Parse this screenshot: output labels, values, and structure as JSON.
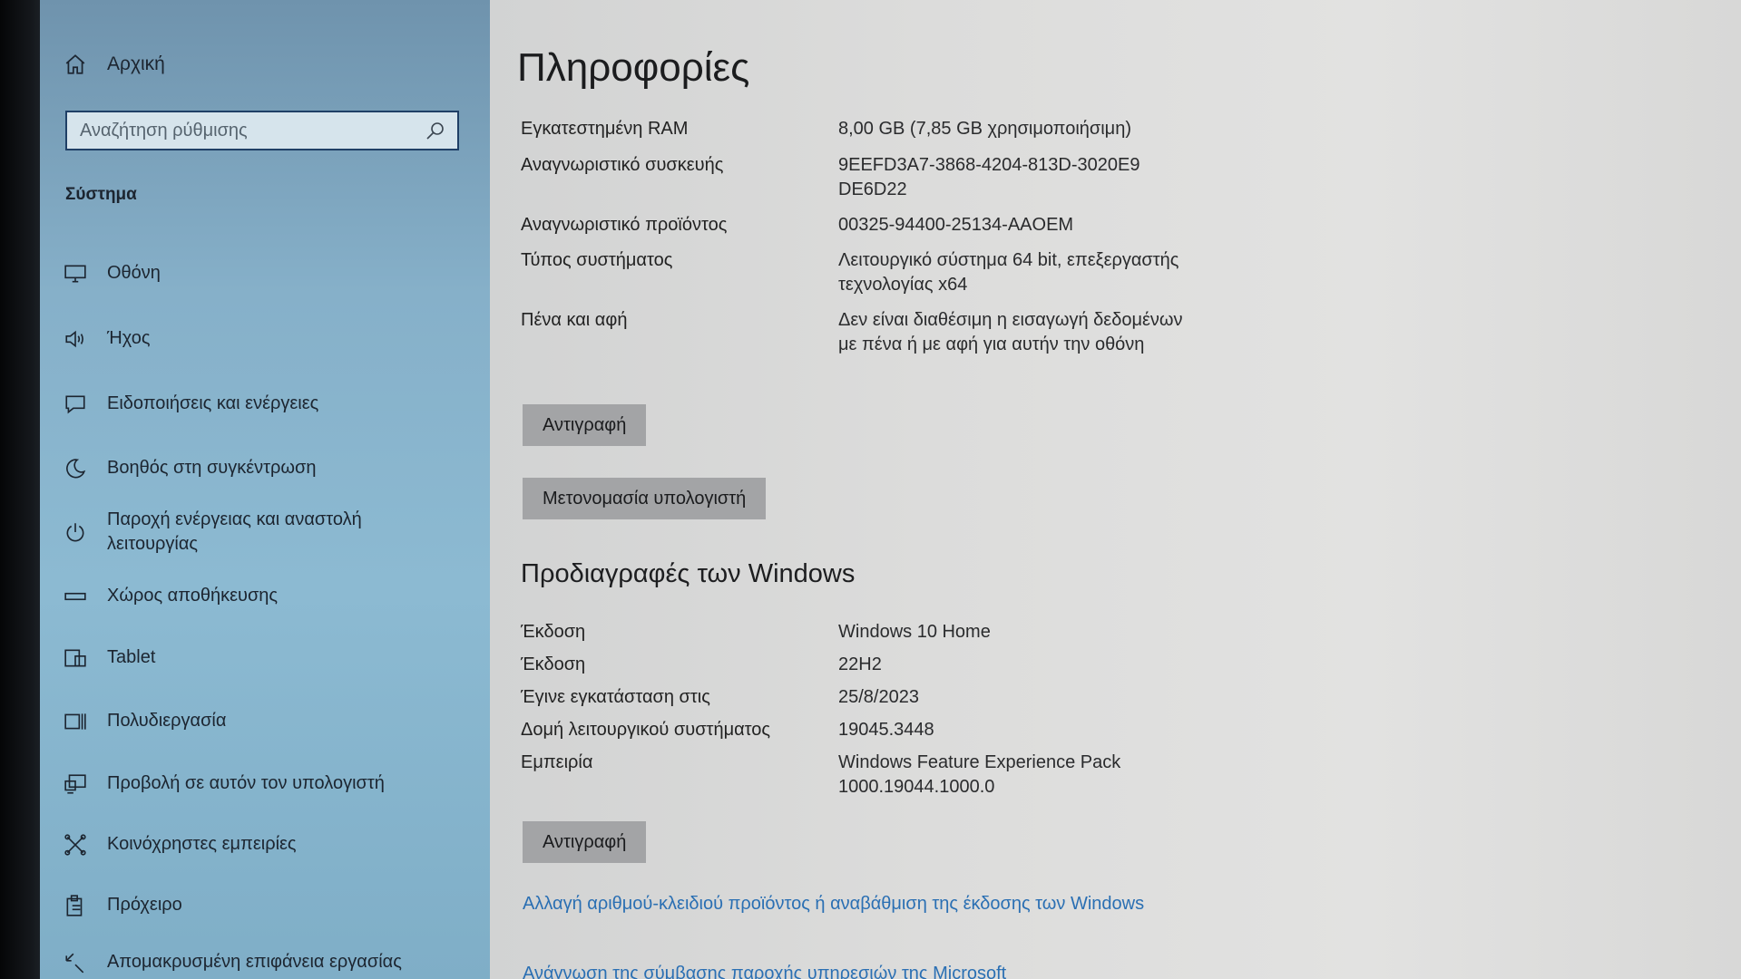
{
  "sidebar": {
    "home_label": "Αρχική",
    "search_placeholder": "Αναζήτηση ρύθμισης",
    "section_heading": "Σύστημα",
    "items": [
      {
        "label": "Οθόνη",
        "icon": "monitor-icon"
      },
      {
        "label": "Ήχος",
        "icon": "speaker-icon"
      },
      {
        "label": "Ειδοποιήσεις και ενέργειες",
        "icon": "notification-icon"
      },
      {
        "label": "Βοηθός στη συγκέντρωση",
        "icon": "moon-icon"
      },
      {
        "label": "Παροχή ενέργειας και αναστολή λειτουργίας",
        "icon": "power-icon"
      },
      {
        "label": "Χώρος αποθήκευσης",
        "icon": "storage-icon"
      },
      {
        "label": "Tablet",
        "icon": "tablet-icon"
      },
      {
        "label": "Πολυδιεργασία",
        "icon": "multitasking-icon"
      },
      {
        "label": "Προβολή σε αυτόν τον υπολογιστή",
        "icon": "projection-icon"
      },
      {
        "label": "Κοινόχρηστες εμπειρίες",
        "icon": "shared-experiences-icon"
      },
      {
        "label": "Πρόχειρο",
        "icon": "clipboard-icon"
      },
      {
        "label": "Απομακρυσμένη επιφάνεια εργασίας",
        "icon": "remote-desktop-icon"
      }
    ]
  },
  "main": {
    "title": "Πληροφορίες",
    "device_specs": [
      {
        "key": "Εγκατεστημένη RAM",
        "value": "8,00 GB (7,85 GB χρησιμοποιήσιμη)"
      },
      {
        "key": "Αναγνωριστικό συσκευής",
        "value": "9EEFD3A7-3868-4204-813D-3020E9 DE6D22"
      },
      {
        "key": "Αναγνωριστικό προϊόντος",
        "value": "00325-94400-25134-AAOEM"
      },
      {
        "key": "Τύπος συστήματος",
        "value": "Λειτουργικό σύστημα 64 bit, επεξεργαστής τεχνολογίας x64"
      },
      {
        "key": "Πένα και αφή",
        "value": "Δεν είναι διαθέσιμη η εισαγωγή δεδομένων με πένα ή με αφή για αυτήν την οθόνη"
      }
    ],
    "copy_button_1": "Αντιγραφή",
    "rename_button": "Μετονομασία υπολογιστή",
    "windows_heading": "Προδιαγραφές των Windows",
    "windows_specs": [
      {
        "key": "Έκδοση",
        "value": "Windows 10 Home"
      },
      {
        "key": "Έκδοση",
        "value": "22H2"
      },
      {
        "key": "Έγινε εγκατάσταση στις",
        "value": "25/8/2023"
      },
      {
        "key": "Δομή λειτουργικού συστήματος",
        "value": "19045.3448"
      },
      {
        "key": "Εμπειρία",
        "value": "Windows Feature Experience Pack 1000.19044.1000.0"
      }
    ],
    "copy_button_2": "Αντιγραφή",
    "link_product_key": "Αλλαγή αριθμού-κλειδιού προϊόντος ή αναβάθμιση της έκδοσης των Windows",
    "link_agreement": "Ανάγνωση της σύμβασης παροχής υπηρεσιών της Microsoft"
  }
}
